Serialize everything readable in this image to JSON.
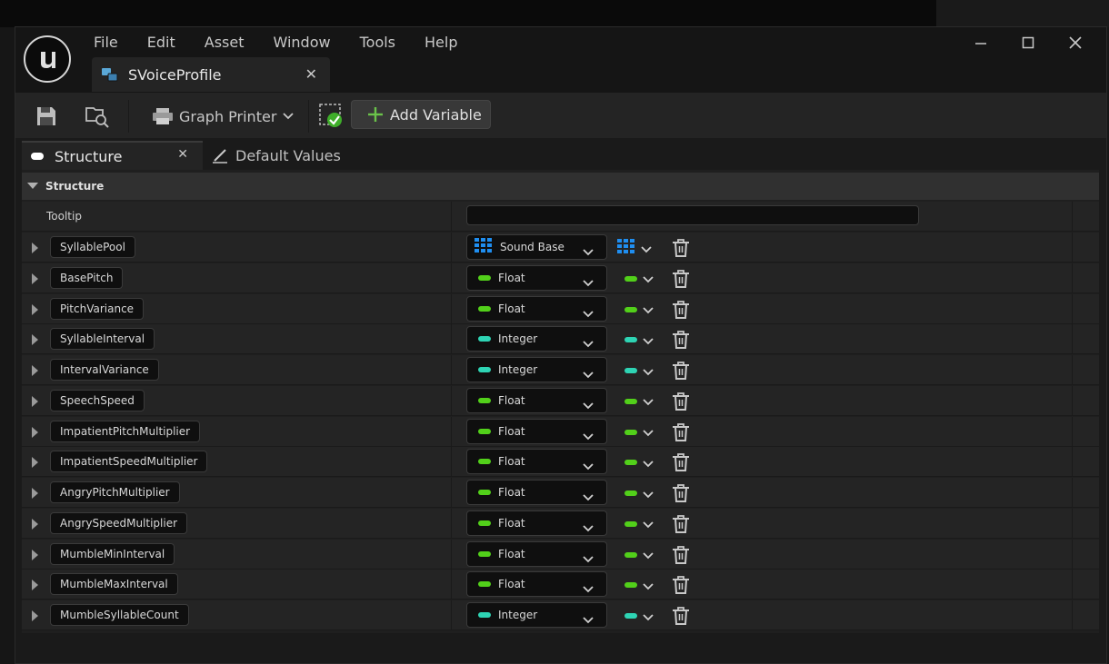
{
  "app": {
    "menu": [
      "File",
      "Edit",
      "Asset",
      "Window",
      "Tools",
      "Help"
    ],
    "document_tab": {
      "label": "SVoiceProfile",
      "icon": "struct-icon"
    }
  },
  "toolbar": {
    "graph_printer_label": "Graph Printer",
    "add_variable_label": "Add Variable"
  },
  "panel_tabs": [
    {
      "label": "Structure",
      "active": true
    },
    {
      "label": "Default Values",
      "active": false
    }
  ],
  "structure": {
    "category_label": "Structure",
    "tooltip_label": "Tooltip",
    "tooltip_value": "",
    "variables": [
      {
        "name": "SyllablePool",
        "type": "Sound Base",
        "kind": "object-array"
      },
      {
        "name": "BasePitch",
        "type": "Float",
        "kind": "float"
      },
      {
        "name": "PitchVariance",
        "type": "Float",
        "kind": "float"
      },
      {
        "name": "SyllableInterval",
        "type": "Integer",
        "kind": "integer"
      },
      {
        "name": "IntervalVariance",
        "type": "Integer",
        "kind": "integer"
      },
      {
        "name": "SpeechSpeed",
        "type": "Float",
        "kind": "float"
      },
      {
        "name": "ImpatientPitchMultiplier",
        "type": "Float",
        "kind": "float"
      },
      {
        "name": "ImpatientSpeedMultiplier",
        "type": "Float",
        "kind": "float"
      },
      {
        "name": "AngryPitchMultiplier",
        "type": "Float",
        "kind": "float"
      },
      {
        "name": "AngrySpeedMultiplier",
        "type": "Float",
        "kind": "float"
      },
      {
        "name": "MumbleMinInterval",
        "type": "Float",
        "kind": "float"
      },
      {
        "name": "MumbleMaxInterval",
        "type": "Float",
        "kind": "float"
      },
      {
        "name": "MumbleSyllableCount",
        "type": "Integer",
        "kind": "integer"
      }
    ]
  },
  "colors": {
    "float": "#52d01a",
    "integer": "#2ed4b4",
    "object": "#1f8ef0",
    "add_icon": "#6ac24a"
  }
}
